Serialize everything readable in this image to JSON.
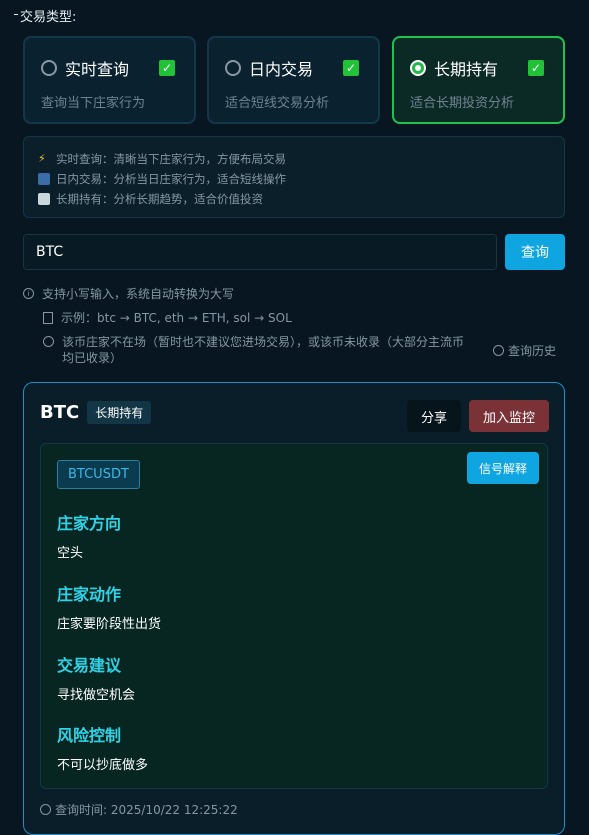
{
  "trade_type": {
    "label": "交易类型:",
    "options": [
      {
        "title": "实时查询",
        "subtitle": "查询当下庄家行为",
        "selected": false,
        "checked": true
      },
      {
        "title": "日内交易",
        "subtitle": "适合短线交易分析",
        "selected": false,
        "checked": true
      },
      {
        "title": "长期持有",
        "subtitle": "适合长期投资分析",
        "selected": true,
        "checked": true
      }
    ]
  },
  "info": {
    "lines": [
      {
        "icon": "lightning-icon",
        "text": "实时查询：清晰当下庄家行为，方便布局交易"
      },
      {
        "icon": "bar-chart-icon",
        "text": "日内交易：分析当日庄家行为，适合短线操作"
      },
      {
        "icon": "trend-chart-icon",
        "text": "长期持有：分析长期趋势，适合价值投资"
      }
    ]
  },
  "search": {
    "value": "BTC",
    "button_label": "查询"
  },
  "tips": {
    "tip1": "支持小写输入，系统自动转换为大写",
    "tip2": "示例：btc → BTC, eth → ETH, sol → SOL",
    "tip3": "该币庄家不在场（暂时也不建议您进场交易），或该币未收录（大部分主流币均已收录）",
    "history_label": "查询历史"
  },
  "result": {
    "coin": "BTC",
    "type_tag": "长期持有",
    "share_label": "分享",
    "monitor_label": "加入监控",
    "pair": "BTCUSDT",
    "explain_label": "信号解释",
    "sections": [
      {
        "heading": "庄家方向",
        "body": "空头"
      },
      {
        "heading": "庄家动作",
        "body": "庄家要阶段性出货"
      },
      {
        "heading": "交易建议",
        "body": "寻找做空机会"
      },
      {
        "heading": "风险控制",
        "body": "不可以抄底做多"
      }
    ],
    "query_time": "查询时间: 2025/10/22 12:25:22"
  },
  "colors": {
    "background": "#071620",
    "accent_blue": "#0ea5e0",
    "selected_green": "#1fc44e",
    "monitor_red": "#7a3237",
    "heading_cyan": "#2fd3e8"
  }
}
